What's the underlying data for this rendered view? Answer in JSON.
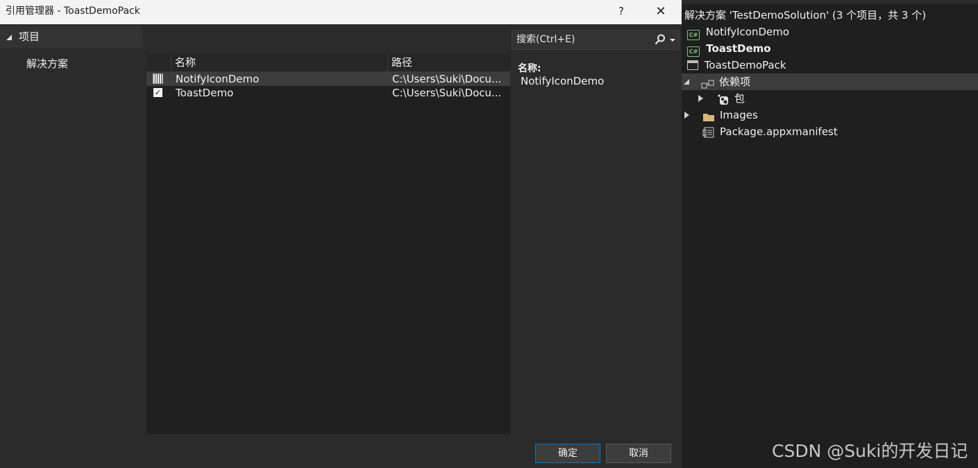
{
  "dialog": {
    "title": "引用管理器 - ToastDemoPack",
    "help_label": "?",
    "close_label": "✕",
    "left_nav": {
      "header": "项目",
      "items": [
        {
          "label": "解决方案"
        }
      ]
    },
    "search": {
      "placeholder": "搜索(Ctrl+E)"
    },
    "grid": {
      "columns": [
        "名称",
        "路径"
      ],
      "rows": [
        {
          "name": "NotifyIconDemo",
          "path": "C:\\Users\\Suki\\Docu...",
          "checked": false
        },
        {
          "name": "ToastDemo",
          "path": "C:\\Users\\Suki\\Docu...",
          "checked": true
        }
      ]
    },
    "details": {
      "label": "名称:",
      "value": "NotifyIconDemo"
    },
    "buttons": {
      "ok": "确定",
      "cancel": "取消"
    }
  },
  "solution_explorer": {
    "solution_label": "解决方案 'TestDemoSolution' (3 个项目，共 3 个)",
    "items": [
      {
        "label": "NotifyIconDemo",
        "icon": "csharp-project-icon"
      },
      {
        "label": "ToastDemo",
        "icon": "csharp-project-icon",
        "bold": true
      },
      {
        "label": "ToastDemoPack",
        "icon": "package-project-icon"
      },
      {
        "label": "依赖项",
        "icon": "dependencies-icon"
      },
      {
        "label": "包",
        "icon": "nuget-package-icon"
      },
      {
        "label": "Images",
        "icon": "folder-icon"
      },
      {
        "label": "Package.appxmanifest",
        "icon": "manifest-icon"
      }
    ]
  },
  "watermark": "CSDN @Suki的开发日记",
  "colors": {
    "accent": "#0078d4",
    "folder": "#dcb67a",
    "csharp": "#7ec27e"
  }
}
